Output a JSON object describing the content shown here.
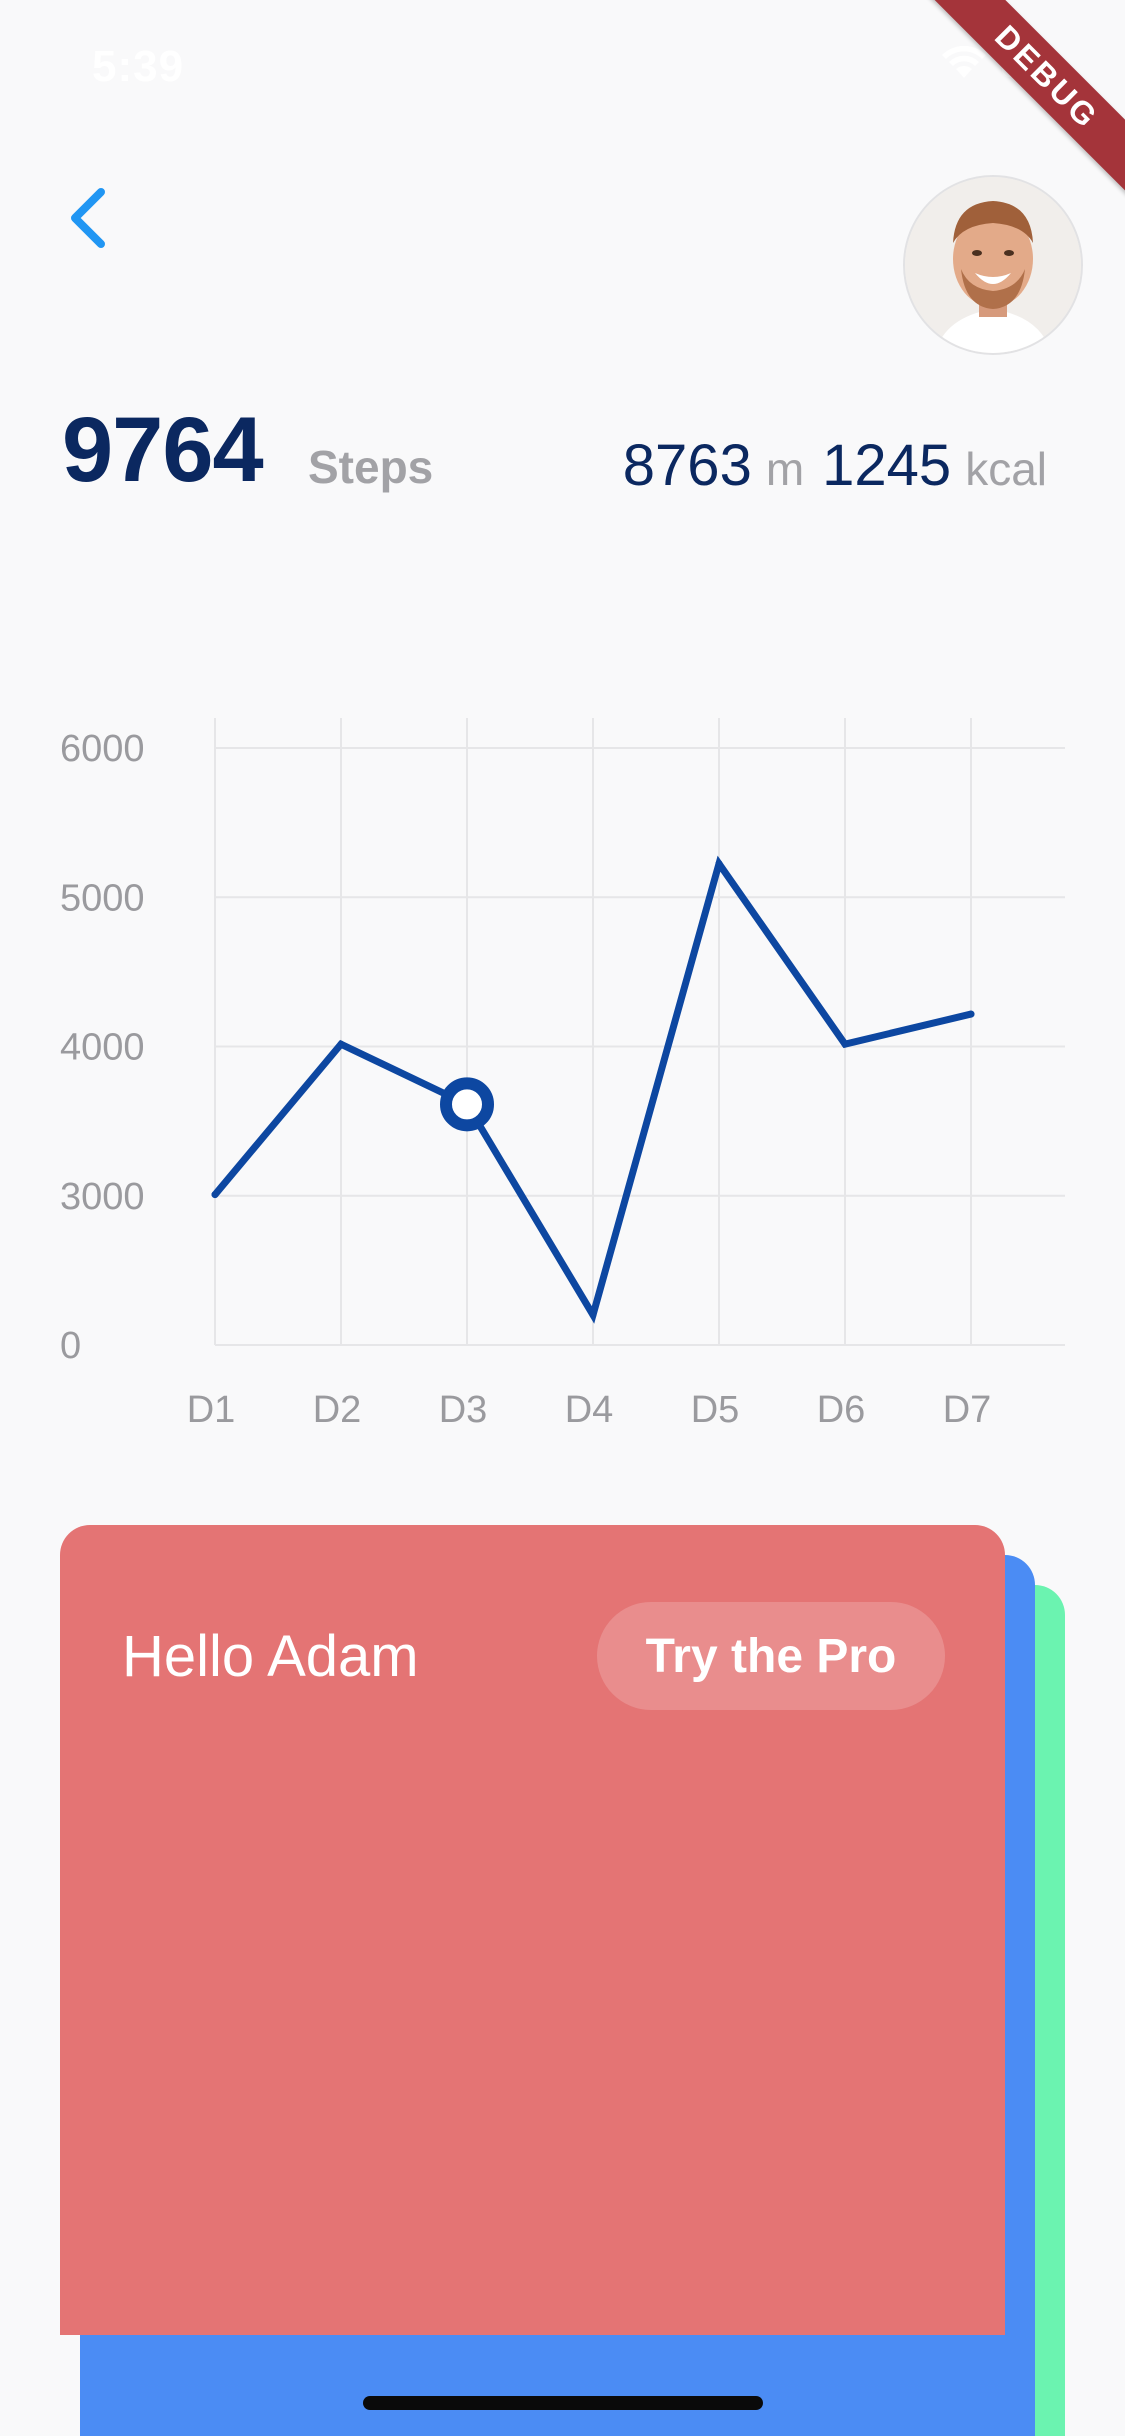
{
  "status_bar": {
    "time": "5:39",
    "debug_label": "DEBUG"
  },
  "header": {
    "back_icon": "chevron-left-icon",
    "avatar": "user-avatar"
  },
  "stats": {
    "steps_value": "9764",
    "steps_label": "Steps",
    "distance_value": "8763",
    "distance_unit": "m",
    "calories_value": "1245",
    "calories_unit": "kcal"
  },
  "chart_data": {
    "type": "line",
    "categories": [
      "D1",
      "D2",
      "D3",
      "D4",
      "D5",
      "D6",
      "D7"
    ],
    "y_tick_labels": [
      "0",
      "3000",
      "4000",
      "5000",
      "6000"
    ],
    "series": [
      {
        "values": [
          3000,
          4000,
          3600,
          2200,
          5200,
          4000,
          4200
        ]
      }
    ],
    "ylim": [
      2000,
      6000
    ],
    "highlight_index": 2,
    "grid": true,
    "line_color": "#0d47a1"
  },
  "card": {
    "greeting": "Hello Adam",
    "pro_button_label": "Try the Pro"
  },
  "colors": {
    "accent_blue": "#2196f3",
    "title_navy": "#0b2860",
    "card_red": "#e47474",
    "card_blue": "#4b8cf4",
    "card_green": "#6bf3b0"
  }
}
